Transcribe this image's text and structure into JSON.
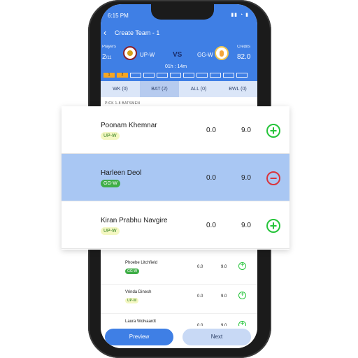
{
  "status": {
    "time": "6:15 PM",
    "icons": "▮▮ ◔ ▮"
  },
  "header": {
    "back_icon": "arrow-left-icon",
    "title": "Create Team - 1",
    "players_label": "Players",
    "players_count": "2",
    "players_total": "/11",
    "team_left": "UP-W",
    "vs": "VS",
    "team_right": "GG-W",
    "credits_label": "Credits",
    "credits_value": "82.0",
    "timer": "01h : 14m",
    "slots": [
      "1",
      "2",
      "",
      "",
      "",
      "",
      "",
      "",
      "",
      "",
      ""
    ]
  },
  "tabs": [
    "WK (0)",
    "BAT (2)",
    "ALL (0)",
    "BWL (0)"
  ],
  "active_tab": 1,
  "pick_text": "PICK 1-8 BATSMEN",
  "players": [
    {
      "name": "Poonam Khemnar",
      "team": "UP-W",
      "points": "0.0",
      "credits": "9.0",
      "action": "add"
    },
    {
      "name": "Harleen Deol",
      "team": "GG-W",
      "points": "0.0",
      "credits": "9.0",
      "action": "remove"
    },
    {
      "name": "Kiran Prabhu Navgire",
      "team": "UP-W",
      "points": "0.0",
      "credits": "9.0",
      "action": "add"
    },
    {
      "name": "Phoebe Litchfield",
      "team": "GG-W",
      "points": "0.0",
      "credits": "9.0",
      "action": "add"
    },
    {
      "name": "Vrinda Dinesh",
      "team": "UP-W",
      "points": "0.0",
      "credits": "9.0",
      "action": "add"
    },
    {
      "name": "Laura Wolvaardt",
      "team": "",
      "points": "0.0",
      "credits": "9.0",
      "action": "add"
    }
  ],
  "buttons": {
    "preview": "Preview",
    "next": "Next"
  },
  "colors": {
    "primary": "#3f7fe5",
    "add": "#25c43a",
    "remove": "#d9343c",
    "selected_row": "#a9c7f3"
  }
}
